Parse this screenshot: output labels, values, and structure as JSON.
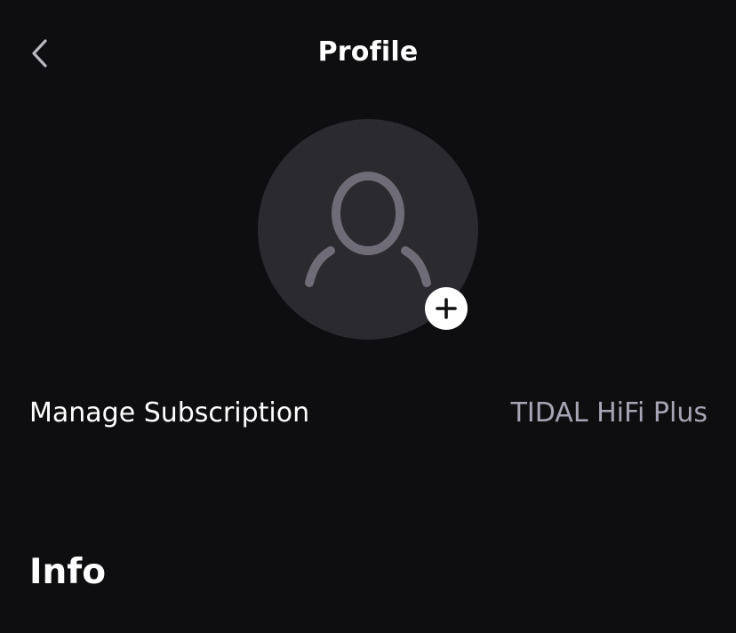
{
  "header": {
    "title": "Profile",
    "back_icon": "chevron-left-icon"
  },
  "avatar": {
    "icon": "user-silhouette-icon",
    "add_icon": "plus-icon"
  },
  "subscription": {
    "label": "Manage Subscription",
    "value": "TIDAL HiFi Plus"
  },
  "sections": {
    "info_title": "Info"
  },
  "colors": {
    "background": "#0e0e10",
    "avatar_bg": "#2a2a2f",
    "avatar_icon": "#6f6c78",
    "value_text": "#a7a4b3"
  }
}
